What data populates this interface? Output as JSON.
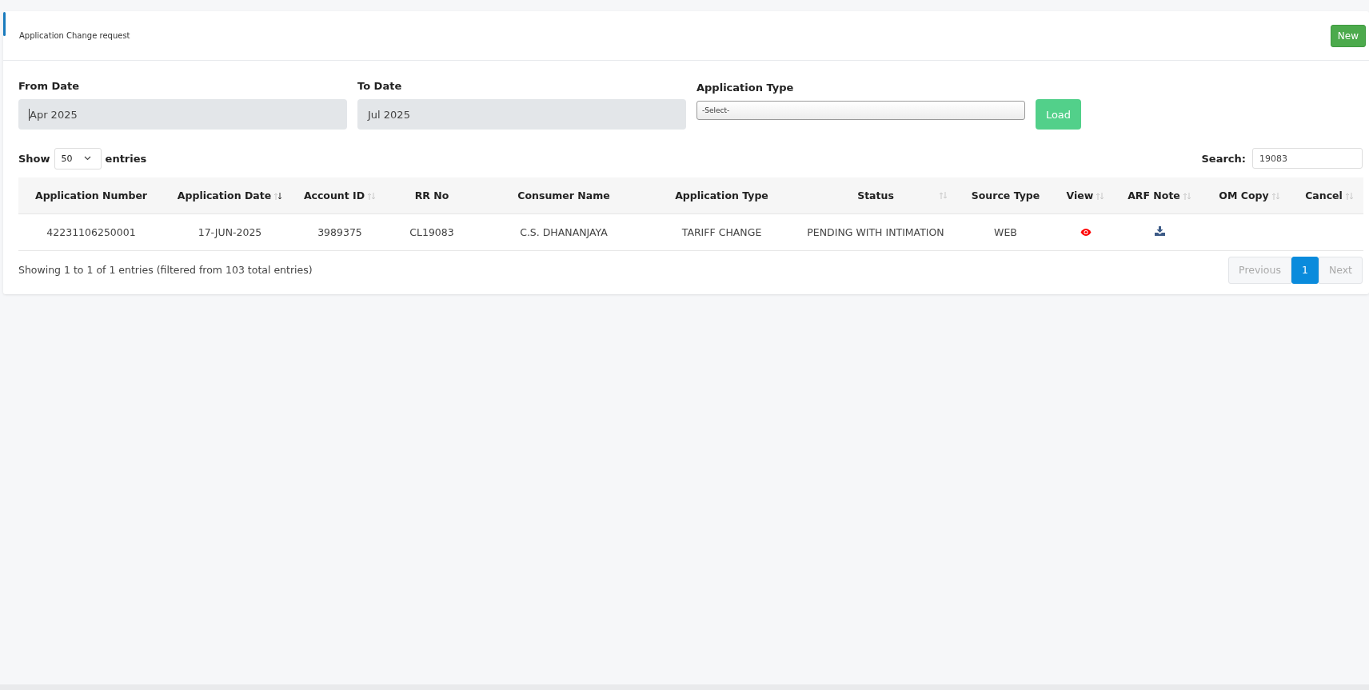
{
  "page_title": "Application Change request",
  "new_button": "New",
  "filters": [
    {
      "label": "From Date",
      "kind": "date",
      "value": "Apr 2025"
    },
    {
      "label": "To Date",
      "kind": "date",
      "value": "Jul 2025"
    },
    {
      "label": "Application Type",
      "kind": "select",
      "value": "-Select-"
    }
  ],
  "load_button": "Load",
  "length": {
    "before": "Show",
    "value": "50",
    "after": "entries"
  },
  "search": {
    "label": "Search:",
    "value": "19083"
  },
  "table": {
    "columns": [
      {
        "label": "Application Number"
      },
      {
        "label": "Application Date",
        "sorted_desc": true
      },
      {
        "label": "Account ID",
        "sorted_desc": false
      },
      {
        "label": "RR No"
      },
      {
        "label": "Consumer Name"
      },
      {
        "label": "Application Type"
      },
      {
        "label": "Status",
        "sorted_desc": false
      },
      {
        "label": "Source Type"
      },
      {
        "label": "View",
        "sorted_desc": false
      },
      {
        "label": "ARF Note",
        "sorted_desc": false
      },
      {
        "label": "OM Copy",
        "sorted_desc": false
      },
      {
        "label": "Cancel",
        "sorted_desc": false
      }
    ],
    "rows": [
      {
        "cells": [
          {
            "kind": "text",
            "text": "42231106250001"
          },
          {
            "kind": "text",
            "text": "17-JUN-2025"
          },
          {
            "kind": "text",
            "text": "3989375"
          },
          {
            "kind": "text",
            "text": "CL19083"
          },
          {
            "kind": "text",
            "text": "C.S. DHANANJAYA"
          },
          {
            "kind": "text",
            "text": "TARIFF CHANGE"
          },
          {
            "kind": "text",
            "text": "PENDING WITH INTIMATION"
          },
          {
            "kind": "text",
            "text": "WEB"
          },
          {
            "kind": "eye"
          },
          {
            "kind": "download"
          },
          {
            "kind": "blank"
          },
          {
            "kind": "blank"
          }
        ]
      }
    ]
  },
  "info": "Showing 1 to 1 of 1 entries (filtered from 103 total entries)",
  "pagination": [
    {
      "label": "Previous",
      "kind": "nav",
      "disabled": true,
      "selected": false
    },
    {
      "label": "1",
      "kind": "page",
      "disabled": false,
      "selected": true
    },
    {
      "label": "Next",
      "kind": "nav",
      "disabled": true,
      "selected": false
    }
  ]
}
